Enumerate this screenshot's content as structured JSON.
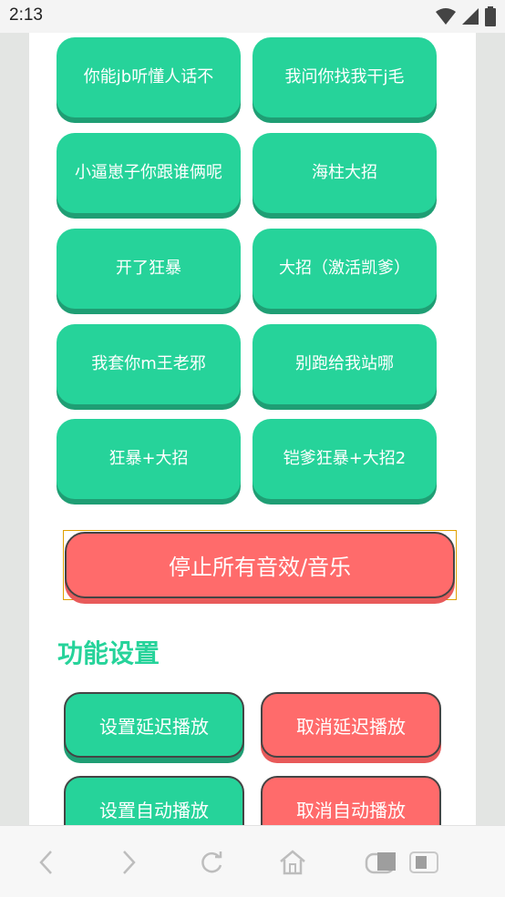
{
  "status_bar": {
    "time": "2:13"
  },
  "sound_buttons": [
    "你能jb听懂人话不",
    "我问你找我干j毛",
    "小逼崽子你跟谁俩呢",
    "海柱大招",
    "开了狂暴",
    "大招（激活凯爹）",
    "我套你m王老邪",
    "别跑给我站哪",
    "狂暴+大招",
    "铠爹狂暴+大招2"
  ],
  "stop_button": "停止所有音效/音乐",
  "settings": {
    "title": "功能设置",
    "set_delay": "设置延迟播放",
    "cancel_delay": "取消延迟播放",
    "set_auto": "设置自动播放",
    "cancel_auto": "取消自动播放"
  },
  "icons": [
    "wifi-icon",
    "signal-icon",
    "battery-icon",
    "back-icon",
    "forward-icon",
    "refresh-icon",
    "home-icon",
    "tabs-icon"
  ],
  "colors": {
    "green": "#26d39a",
    "red": "#ff6b6b"
  }
}
